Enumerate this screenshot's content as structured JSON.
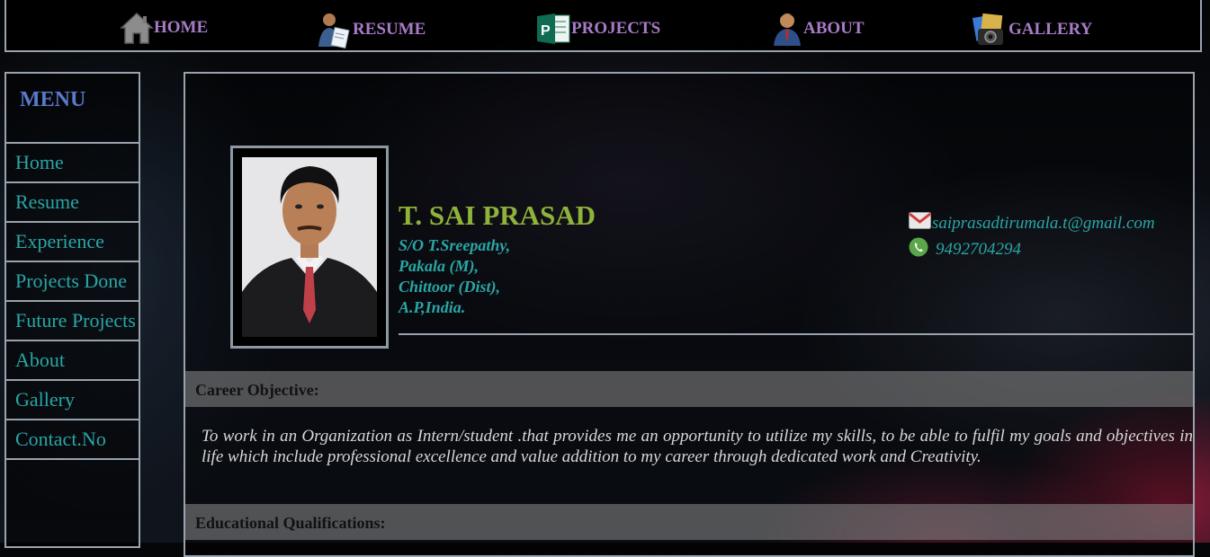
{
  "nav": {
    "items": [
      {
        "label": "HOME",
        "icon": "home-icon"
      },
      {
        "label": "RESUME",
        "icon": "resume-icon"
      },
      {
        "label": "PROJECTS",
        "icon": "projects-icon"
      },
      {
        "label": "ABOUT",
        "icon": "about-icon"
      },
      {
        "label": "GALLERY",
        "icon": "gallery-icon"
      }
    ]
  },
  "sidebar": {
    "title": "MENU",
    "items": [
      {
        "label": "Home"
      },
      {
        "label": "Resume"
      },
      {
        "label": "Experience"
      },
      {
        "label": "Projects Done"
      },
      {
        "label": "Future Projects"
      },
      {
        "label": "About"
      },
      {
        "label": "Gallery"
      },
      {
        "label": "Contact.No"
      }
    ]
  },
  "profile": {
    "name": "T. SAI PRASAD",
    "address": [
      "S/O T.Sreepathy,",
      "Pakala (M),",
      "Chittoor (Dist),",
      "A.P,India."
    ],
    "email": "saiprasadtirumala.t@gmail.com",
    "phone": "9492704294"
  },
  "sections": {
    "career_title": "Career Objective:",
    "career_text": "To work in an Organization as Intern/student .that provides me an opportunity to utilize my skills, to be able to fulfil my goals and objectives in life which include professional excellence and value addition to my career through dedicated work and Creativity.",
    "education_title": "Educational Qualifications:"
  },
  "colors": {
    "nav_text": "#a77bc6",
    "menu_title": "#5b79c9",
    "sidebar_text": "#2aa6a6",
    "name": "#8fb33a",
    "border": "#9aa3ad"
  }
}
